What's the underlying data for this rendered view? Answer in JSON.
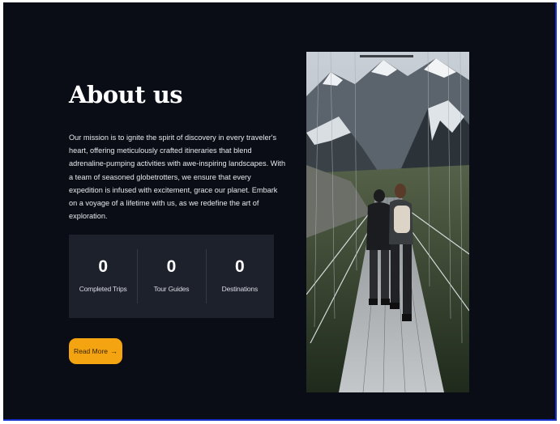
{
  "about": {
    "title": "About us",
    "mission": "Our mission is to ignite the spirit of discovery in every traveler's heart, offering meticulously crafted itineraries that blend adrenaline-pumping activities with awe-inspiring landscapes. With a team of seasoned globetrotters, we ensure that every expedition is infused with excitement, grace our planet. Embark on a voyage of a lifetime with us, as we redefine the art of exploration."
  },
  "stats": [
    {
      "value": "0",
      "label": "Completed Trips"
    },
    {
      "value": "0",
      "label": "Tour Guides"
    },
    {
      "value": "0",
      "label": "Destinations"
    }
  ],
  "cta": {
    "label": "Read More",
    "icon": "arrow-right-icon",
    "icon_glyph": "→"
  },
  "colors": {
    "background": "#0a0d16",
    "stats_panel": "#1d212c",
    "accent": "#f3a410",
    "frame_border": "#1530c8"
  }
}
